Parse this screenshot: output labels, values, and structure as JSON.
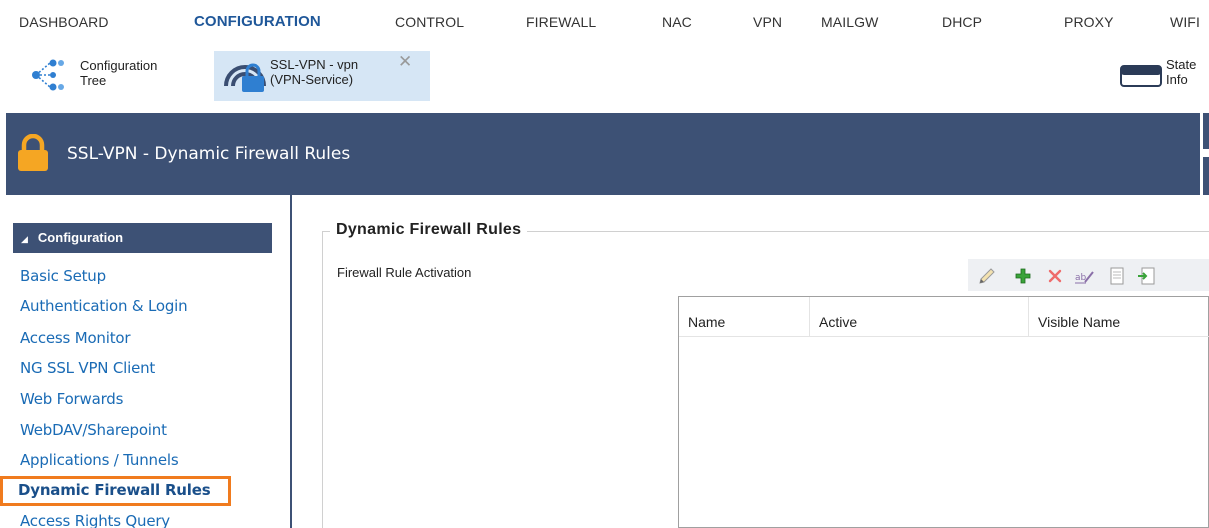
{
  "topnav": {
    "items": [
      "DASHBOARD",
      "CONFIGURATION",
      "CONTROL",
      "FIREWALL",
      "NAC",
      "VPN",
      "MAILGW",
      "DHCP",
      "PROXY",
      "WIFI"
    ],
    "active": "CONFIGURATION"
  },
  "subbar": {
    "config_tree": {
      "line1": "Configuration",
      "line2": "Tree"
    },
    "vpn_tab": {
      "line1": "SSL-VPN - vpn",
      "line2": "(VPN-Service)",
      "close": "✕"
    },
    "state_info": {
      "line1": "State",
      "line2": "Info"
    }
  },
  "banner": {
    "title": "SSL-VPN - Dynamic Firewall Rules"
  },
  "sidebar": {
    "header": "Configuration",
    "header_glyph": "◢",
    "items": [
      "Basic Setup",
      "Authentication & Login",
      "Access Monitor",
      "NG SSL VPN Client",
      "Web Forwards",
      "WebDAV/Sharepoint",
      "Applications / Tunnels",
      "Dynamic Firewall Rules",
      "Access Rights Query"
    ],
    "active_item": "Dynamic Firewall Rules"
  },
  "main": {
    "group_title": "Dynamic Firewall Rules",
    "section_label": "Firewall Rule Activation",
    "toolbar_icons": [
      "edit-icon",
      "add-icon",
      "delete-icon",
      "rename-icon",
      "copy-icon",
      "paste-icon"
    ],
    "grid_columns": [
      "Name",
      "Active",
      "Visible Name"
    ]
  },
  "colors": {
    "banner": "#3d5175",
    "active_nav": "#1f5799",
    "link": "#1a6bb5",
    "highlight": "#f07b1e",
    "lock": "#f5a623"
  }
}
